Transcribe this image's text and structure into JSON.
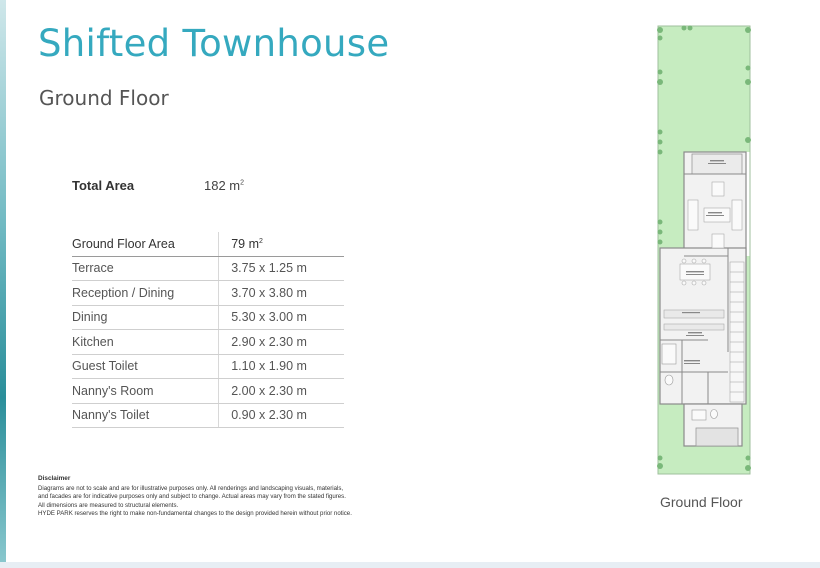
{
  "header": {
    "title": "Shifted Townhouse",
    "subtitle": "Ground Floor"
  },
  "total_area": {
    "label": "Total Area",
    "value": "182 m",
    "unit_sup": "2"
  },
  "area_table": {
    "header": {
      "label": "Ground Floor Area",
      "value": "79 m",
      "unit_sup": "2"
    },
    "rows": [
      {
        "room": "Terrace",
        "size": "3.75 x 1.25 m"
      },
      {
        "room": "Reception / Dining",
        "size": "3.70 x 3.80 m"
      },
      {
        "room": "Dining",
        "size": "5.30 x 3.00 m"
      },
      {
        "room": "Kitchen",
        "size": "2.90 x 2.30 m"
      },
      {
        "room": "Guest Toilet",
        "size": "1.10 x 1.90 m"
      },
      {
        "room": "Nanny's Room",
        "size": "2.00 x 2.30 m"
      },
      {
        "room": "Nanny's Toilet",
        "size": "0.90 x 2.30 m"
      }
    ]
  },
  "disclaimer": {
    "heading": "Disclaimer",
    "lines": [
      "Diagrams are not to scale and are for illustrative purposes only. All renderings and landscaping visuals, materials,",
      "and facades are for indicative purposes only and subject to change. Actual areas may vary from the stated figures.",
      "All dimensions are measured to structural elements.",
      "HYDE PARK reserves the right to make non-fundamental changes to the design provided herein without prior notice."
    ]
  },
  "floor_plan": {
    "caption": "Ground Floor",
    "colors": {
      "garden": "#c6ecc0",
      "tree": "#7ab87a",
      "wall": "#8a8a8a",
      "floor": "#f2f2f2"
    }
  }
}
